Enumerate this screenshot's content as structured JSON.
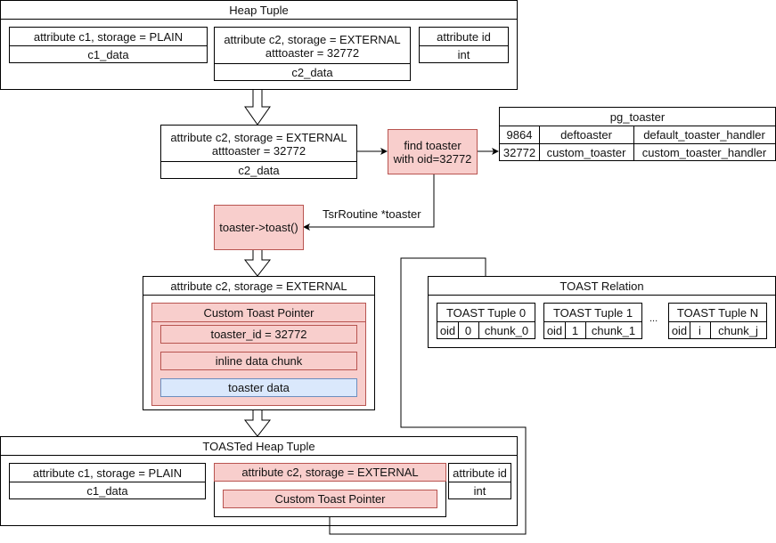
{
  "heap_tuple": {
    "title": "Heap Tuple",
    "c1": {
      "header": "attribute c1, storage = PLAIN",
      "value": "c1_data"
    },
    "c2": {
      "header_line1": "attribute c2, storage = EXTERNAL",
      "header_line2": "atttoaster = 32772",
      "value": "c2_data"
    },
    "id": {
      "header": "attribute id",
      "value": "int"
    }
  },
  "extracted_c2": {
    "header_line1": "attribute c2, storage = EXTERNAL",
    "header_line2": "atttoaster = 32772",
    "value": "c2_data"
  },
  "find_toaster": {
    "line1": "find toaster",
    "line2": "with oid=32772"
  },
  "pg_toaster": {
    "title": "pg_toaster",
    "rows": [
      [
        "9864",
        "deftoaster",
        "default_toaster_handler"
      ],
      [
        "32772",
        "custom_toaster",
        "custom_toaster_handler"
      ]
    ]
  },
  "edge_label": "TsrRoutine *toaster",
  "toast_call": "toaster->toast()",
  "external_attr": {
    "header": "attribute c2, storage = EXTERNAL",
    "pointer_title": "Custom Toast Pointer",
    "fields": [
      "toaster_id = 32772",
      "inline data chunk",
      "toaster data"
    ]
  },
  "toast_relation": {
    "title": "TOAST Relation",
    "ellipsis": "...",
    "tuples": [
      {
        "title": "TOAST Tuple 0",
        "cells": [
          "oid",
          "0",
          "chunk_0"
        ]
      },
      {
        "title": "TOAST Tuple 1",
        "cells": [
          "oid",
          "1",
          "chunk_1"
        ]
      },
      {
        "title": "TOAST Tuple N",
        "cells": [
          "oid",
          "i",
          "chunk_j"
        ]
      }
    ]
  },
  "toasted_tuple": {
    "title": "TOASTed Heap Tuple",
    "c1": {
      "header": "attribute c1, storage = PLAIN",
      "value": "c1_data"
    },
    "c2": {
      "header": "attribute c2, storage = EXTERNAL",
      "pointer": "Custom Toast Pointer"
    },
    "id": {
      "header": "attribute id",
      "value": "int"
    }
  },
  "colors": {
    "highlight_fill": "#f8cecc",
    "highlight_stroke": "#b85450",
    "data_fill": "#dae8fc",
    "data_stroke": "#6c8ebf"
  }
}
